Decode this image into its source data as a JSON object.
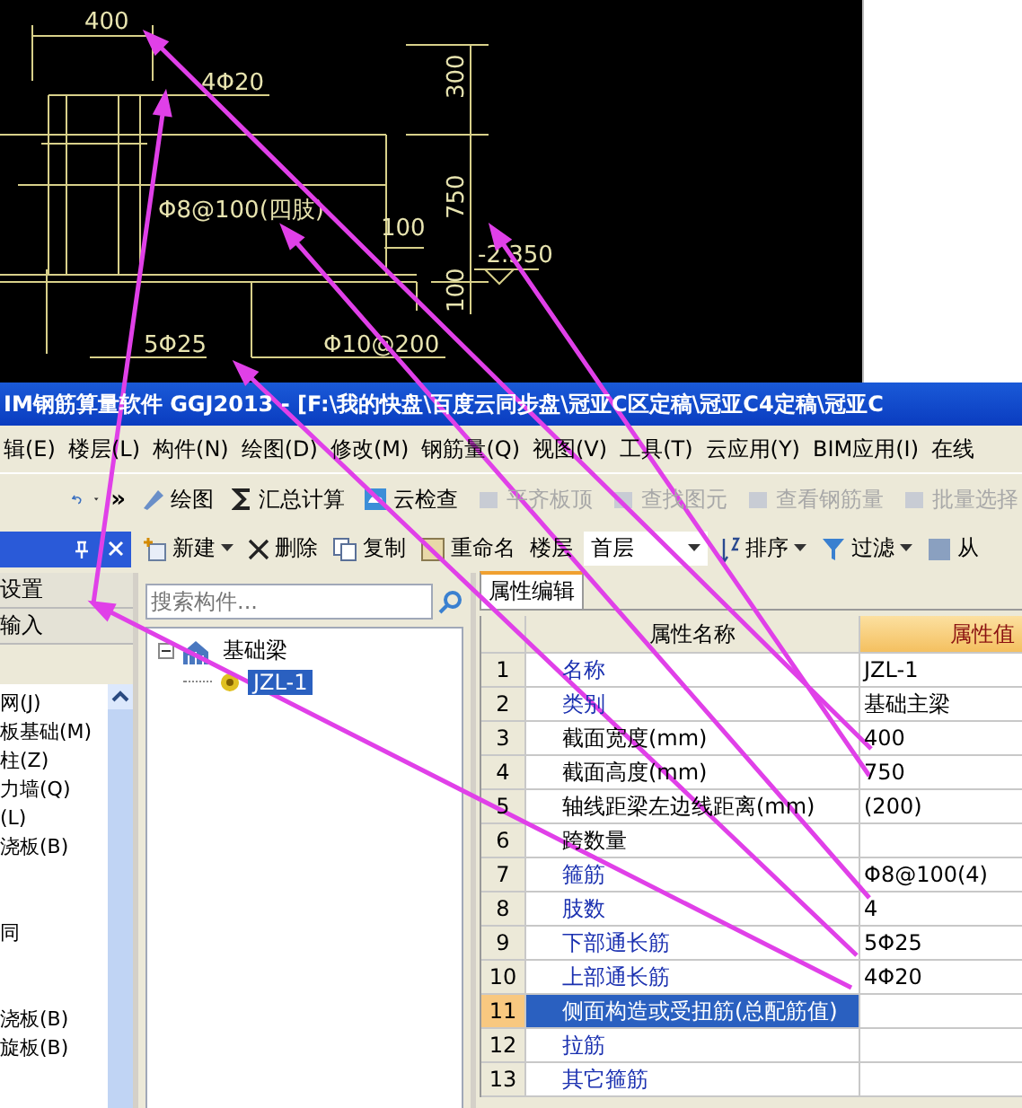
{
  "cad_drawing": {
    "labels": [
      "400",
      "4Φ20",
      "300",
      "Φ8@100(四肢)",
      "100",
      "750",
      "-2.350",
      "100",
      "5Φ25",
      "Φ10@200"
    ]
  },
  "window": {
    "title": "IM钢筋算量软件 GGJ2013 - [F:\\我的快盘\\百度云同步盘\\冠亚C区定稿\\冠亚C4定稿\\冠亚C"
  },
  "menu": [
    "辑(E)",
    "楼层(L)",
    "构件(N)",
    "绘图(D)",
    "修改(M)",
    "钢筋量(Q)",
    "视图(V)",
    "工具(T)",
    "云应用(Y)",
    "BIM应用(I)",
    "在线"
  ],
  "toolbar_more": "»",
  "toolbar": [
    {
      "label": "绘图",
      "kind": "draw",
      "disabled": false
    },
    {
      "label": "汇总计算",
      "kind": "sigma",
      "disabled": false
    },
    {
      "label": "云检查",
      "kind": "cloud",
      "disabled": false
    },
    {
      "label": "平齐板顶",
      "kind": "level",
      "disabled": true
    },
    {
      "label": "查找图元",
      "kind": "find",
      "disabled": true
    },
    {
      "label": "查看钢筋量",
      "kind": "rebar",
      "disabled": true
    },
    {
      "label": "批量选择",
      "kind": "batch",
      "disabled": true
    }
  ],
  "left_panel": {
    "buttons": [
      "设置",
      "输入"
    ],
    "groups": [
      [
        "网(J)",
        "板基础(M)",
        "柱(Z)",
        "力墙(Q)",
        "(L)",
        "浇板(B)"
      ],
      [
        "同"
      ],
      [
        "浇板(B)",
        "旋板(B)"
      ]
    ]
  },
  "component_toolbar": {
    "buttons": [
      {
        "label": "新建",
        "kind": "new",
        "dropdown": true
      },
      {
        "label": "删除",
        "kind": "delete",
        "dropdown": false
      },
      {
        "label": "复制",
        "kind": "copy",
        "dropdown": false
      },
      {
        "label": "重命名",
        "kind": "rename",
        "dropdown": false
      }
    ],
    "floor_label": "楼层",
    "floor_value": "首层",
    "sort": "排序",
    "filter": "过滤",
    "from": "从"
  },
  "search": {
    "placeholder": "搜索构件..."
  },
  "tree": [
    {
      "label": "基础梁",
      "expanded": true,
      "selected": false,
      "children": [
        {
          "label": "JZL-1",
          "selected": true
        }
      ]
    }
  ],
  "properties": {
    "tab": "属性编辑",
    "columns": [
      "属性名称",
      "属性值"
    ],
    "rows": [
      {
        "index": "1",
        "name": "名称",
        "value": "JZL-1",
        "kind": "public",
        "selected": false
      },
      {
        "index": "2",
        "name": "类别",
        "value": "基础主梁",
        "kind": "public",
        "selected": false
      },
      {
        "index": "3",
        "name": "截面宽度(mm)",
        "value": "400",
        "kind": "private",
        "selected": false
      },
      {
        "index": "4",
        "name": "截面高度(mm)",
        "value": "750",
        "kind": "private",
        "selected": false
      },
      {
        "index": "5",
        "name": "轴线距梁左边线距离(mm)",
        "value": "(200)",
        "kind": "private",
        "selected": false
      },
      {
        "index": "6",
        "name": "跨数量",
        "kind": "private",
        "selected": false
      },
      {
        "index": "7",
        "name": "箍筋",
        "value": "Φ8@100(4)",
        "kind": "public",
        "selected": false
      },
      {
        "index": "8",
        "name": "肢数",
        "value": "4",
        "kind": "public",
        "selected": false
      },
      {
        "index": "9",
        "name": "下部通长筋",
        "value": "5Φ25",
        "kind": "public",
        "selected": false
      },
      {
        "index": "10",
        "name": "上部通长筋",
        "value": "4Φ20",
        "kind": "public",
        "selected": false
      },
      {
        "index": "11",
        "name": "侧面构造或受扭筋(总配筋值)",
        "kind": "public",
        "selected": true
      },
      {
        "index": "12",
        "name": "拉筋",
        "kind": "public",
        "selected": false
      },
      {
        "index": "13",
        "name": "其它箍筋",
        "kind": "public",
        "selected": false
      }
    ]
  }
}
